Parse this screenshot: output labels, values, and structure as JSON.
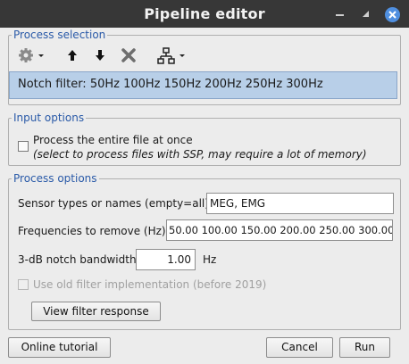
{
  "window": {
    "title": "Pipeline editor"
  },
  "process_selection": {
    "legend": "Process selection",
    "toolbar": [
      {
        "name": "gear-menu",
        "icon": "gear-icon"
      },
      {
        "name": "move-up",
        "icon": "arrow-up-icon"
      },
      {
        "name": "move-down",
        "icon": "arrow-down-icon"
      },
      {
        "name": "delete",
        "icon": "delete-x-icon"
      },
      {
        "name": "pipeline-menu",
        "icon": "tree-icon"
      }
    ],
    "selected_process": "Notch filter: 50Hz 100Hz 150Hz 200Hz 250Hz 300Hz"
  },
  "input_options": {
    "legend": "Input options",
    "entire_file_label": "Process the entire file at once",
    "entire_file_hint": "(select to process files with SSP, may require a lot of memory)",
    "entire_file_checked": false
  },
  "process_options": {
    "legend": "Process options",
    "sensor_label": "Sensor types or names (empty=all):",
    "sensor_value": "MEG, EMG",
    "freq_label": "Frequencies to remove (Hz):",
    "freq_value": "50.00 100.00 150.00 200.00 250.00 300.00",
    "bandwidth_label": "3-dB notch bandwidth:",
    "bandwidth_value": "1.00",
    "bandwidth_unit": "Hz",
    "old_filter_label": "Use old filter implementation (before 2019)",
    "old_filter_checked": false,
    "view_response_label": "View filter response"
  },
  "footer": {
    "tutorial_label": "Online tutorial",
    "cancel_label": "Cancel",
    "run_label": "Run"
  },
  "colors": {
    "titlebar": "#373737",
    "legend": "#2a5aa8",
    "selection": "#b8cfe8",
    "close_button": "#4f8fe0"
  }
}
